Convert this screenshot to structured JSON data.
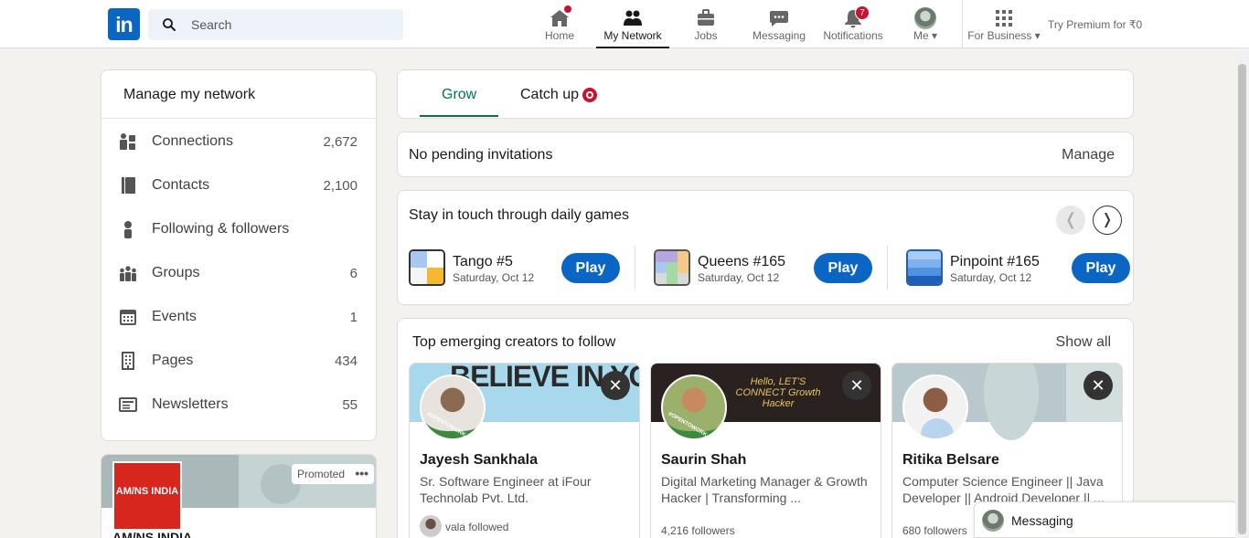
{
  "nav": {
    "logo": "in",
    "search_placeholder": "Search",
    "items": [
      {
        "label": "Home",
        "badge": ""
      },
      {
        "label": "My Network",
        "badge": ""
      },
      {
        "label": "Jobs"
      },
      {
        "label": "Messaging"
      },
      {
        "label": "Notifications",
        "badge": "7"
      },
      {
        "label": "Me"
      },
      {
        "label": "For Business"
      }
    ],
    "premium": "Try Premium for ₹0"
  },
  "sidebar": {
    "title": "Manage my network",
    "items": [
      {
        "label": "Connections",
        "count": "2,672"
      },
      {
        "label": "Contacts",
        "count": "2,100"
      },
      {
        "label": "Following & followers",
        "count": ""
      },
      {
        "label": "Groups",
        "count": "6"
      },
      {
        "label": "Events",
        "count": "1"
      },
      {
        "label": "Pages",
        "count": "434"
      },
      {
        "label": "Newsletters",
        "count": "55"
      }
    ],
    "promo": {
      "tag": "Promoted",
      "logo_text": "AM/NS INDIA",
      "company": "AM/NS INDIA"
    }
  },
  "tabs": [
    {
      "label": "Grow"
    },
    {
      "label": "Catch up"
    }
  ],
  "invitations": {
    "text": "No pending invitations",
    "manage": "Manage"
  },
  "games": {
    "title": "Stay in touch through daily games",
    "items": [
      {
        "name": "Tango #5",
        "date": "Saturday, Oct 12",
        "button": "Play"
      },
      {
        "name": "Queens #165",
        "date": "Saturday, Oct 12",
        "button": "Play"
      },
      {
        "name": "Pinpoint #165",
        "date": "Saturday, Oct 12",
        "button": "Play"
      }
    ]
  },
  "creators": {
    "title": "Top emerging creators to follow",
    "show_all": "Show all",
    "items": [
      {
        "name": "Jayesh Sankhala",
        "desc": "Sr. Software Engineer at iFour Technolab Pvt. Ltd.",
        "foot": "vala followed",
        "banner_text": "BELIEVE IN YOURSELF"
      },
      {
        "name": "Saurin Shah",
        "desc": "Digital Marketing Manager & Growth Hacker | Transforming ...",
        "foot": "4,216 followers",
        "banner_text": "Hello, LET'S CONNECT Growth Hacker"
      },
      {
        "name": "Ritika Belsare",
        "desc": "Computer Science Engineer || Java Developer || Android Developer || ...",
        "foot": "680 followers"
      }
    ],
    "badge_text": "#OPENTOWORK"
  },
  "messaging": {
    "label": "Messaging"
  },
  "colors": {
    "brand": "#0a66c2",
    "green": "#01754f",
    "badge": "#cb112d"
  }
}
